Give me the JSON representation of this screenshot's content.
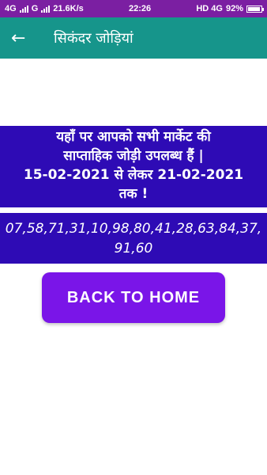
{
  "statusbar": {
    "left_net1": "4G",
    "left_net2": "G",
    "speed": "21.6K/s",
    "time": "22:26",
    "right_net": "HD 4G",
    "battery": "92%",
    "battery_level": 0.92
  },
  "appbar": {
    "back_icon": "arrow-left-icon",
    "title": "सिकंदर जोड़ियां",
    "color": "#16958b"
  },
  "notice": {
    "line1": "यहाँ पर आपको सभी मार्केट की",
    "line2": "साप्ताहिक जोड़ी उपलब्ध हैं |",
    "line3": "15-02-2021 से लेकर 21-02-2021",
    "line4": "तक !",
    "color": "#2e0bb5"
  },
  "numbers": {
    "text": "07,58,71,31,10,98,80,41,28,63,84,37,91,60"
  },
  "home_button": {
    "label": "BACK TO HOME",
    "color": "#7a15e8"
  }
}
